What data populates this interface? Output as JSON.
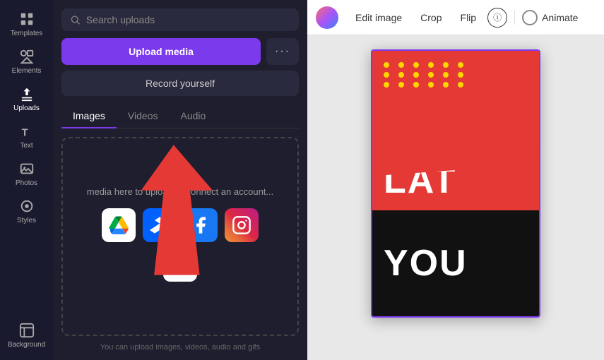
{
  "sidebar": {
    "items": [
      {
        "id": "templates",
        "label": "Templates",
        "icon": "grid"
      },
      {
        "id": "elements",
        "label": "Elements",
        "icon": "elements"
      },
      {
        "id": "uploads",
        "label": "Uploads",
        "icon": "upload",
        "active": true
      },
      {
        "id": "text",
        "label": "Text",
        "icon": "text"
      },
      {
        "id": "photos",
        "label": "Photos",
        "icon": "photo"
      },
      {
        "id": "styles",
        "label": "Styles",
        "icon": "styles"
      },
      {
        "id": "background",
        "label": "Background",
        "icon": "background"
      }
    ]
  },
  "panel": {
    "search_placeholder": "Search uploads",
    "upload_media_label": "Upload media",
    "more_label": "···",
    "record_label": "Record yourself",
    "tabs": [
      {
        "id": "images",
        "label": "Images",
        "active": true
      },
      {
        "id": "videos",
        "label": "Videos"
      },
      {
        "id": "audio",
        "label": "Audio"
      }
    ],
    "upload_area_text": "media here to upload or connect an account...",
    "upload_hint": "You can upload images, videos, audio and gifs",
    "services": [
      {
        "id": "google-drive",
        "label": "Google Drive"
      },
      {
        "id": "dropbox",
        "label": "Dropbox"
      },
      {
        "id": "facebook",
        "label": "Facebook"
      },
      {
        "id": "instagram",
        "label": "Instagram"
      },
      {
        "id": "google-photos",
        "label": "Google Photos"
      }
    ]
  },
  "toolbar": {
    "edit_image_label": "Edit image",
    "crop_label": "Crop",
    "flip_label": "Flip",
    "info_label": "ⓘ",
    "animate_label": "Animate"
  },
  "canvas": {
    "design_text_top": "LAT",
    "design_text_bottom": "YOU"
  }
}
